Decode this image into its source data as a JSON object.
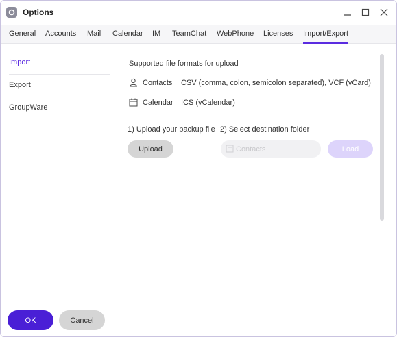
{
  "window": {
    "title": "Options",
    "controls": {
      "minimize": "minimize-icon",
      "maximize": "maximize-icon",
      "close": "close-icon"
    }
  },
  "tabs": [
    {
      "label": "General"
    },
    {
      "label": "Accounts"
    },
    {
      "label": "Mail"
    },
    {
      "label": "Calendar"
    },
    {
      "label": "IM"
    },
    {
      "label": "TeamChat"
    },
    {
      "label": "WebPhone"
    },
    {
      "label": "Licenses"
    },
    {
      "label": "Import/Export",
      "active": true
    }
  ],
  "sidebar": {
    "items": [
      {
        "label": "Import",
        "active": true
      },
      {
        "label": "Export"
      },
      {
        "label": "GroupWare"
      }
    ]
  },
  "import": {
    "heading": "Supported file formats for upload",
    "formats": [
      {
        "icon": "user-icon",
        "name": "Contacts",
        "desc": "CSV (comma, colon, semicolon separated), VCF (vCard)"
      },
      {
        "icon": "calendar-icon",
        "name": "Calendar",
        "desc": "ICS (vCalendar)"
      }
    ],
    "step1_label": "1) Upload your backup file",
    "step2_label": "2) Select destination folder",
    "upload_button": "Upload",
    "folder_value": "Contacts",
    "load_button": "Load"
  },
  "footer": {
    "ok_button": "OK",
    "cancel_button": "Cancel"
  },
  "colors": {
    "accent": "#4a1fd6",
    "accent_light": "#ddd4fb",
    "active_text": "#5a2be0"
  }
}
